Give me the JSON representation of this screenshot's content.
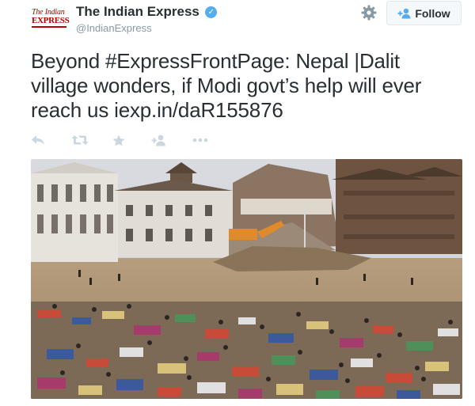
{
  "header": {
    "avatar_line1": "The Indian",
    "avatar_line2": "EXPRESS",
    "display_name": "The Indian Express",
    "handle": "@IndianExpress",
    "follow_label": "Follow"
  },
  "tweet": {
    "text_before_link": "Beyond #ExpressFrontPage: Nepal |Dalit village wonders, if Modi govt’s help will ever reach us ",
    "link": "iexp.in/daR155876"
  },
  "actions": [
    {
      "name": "reply-icon"
    },
    {
      "name": "retweet-icon"
    },
    {
      "name": "favorite-star-icon"
    },
    {
      "name": "follow-add-icon"
    },
    {
      "name": "more-ellipsis-icon"
    }
  ],
  "colors": {
    "text": "#292f33",
    "muted": "#8899a6",
    "action_icon": "#ccd6dd",
    "verified_badge": "#55acee",
    "brand_red": "#bb0000"
  }
}
